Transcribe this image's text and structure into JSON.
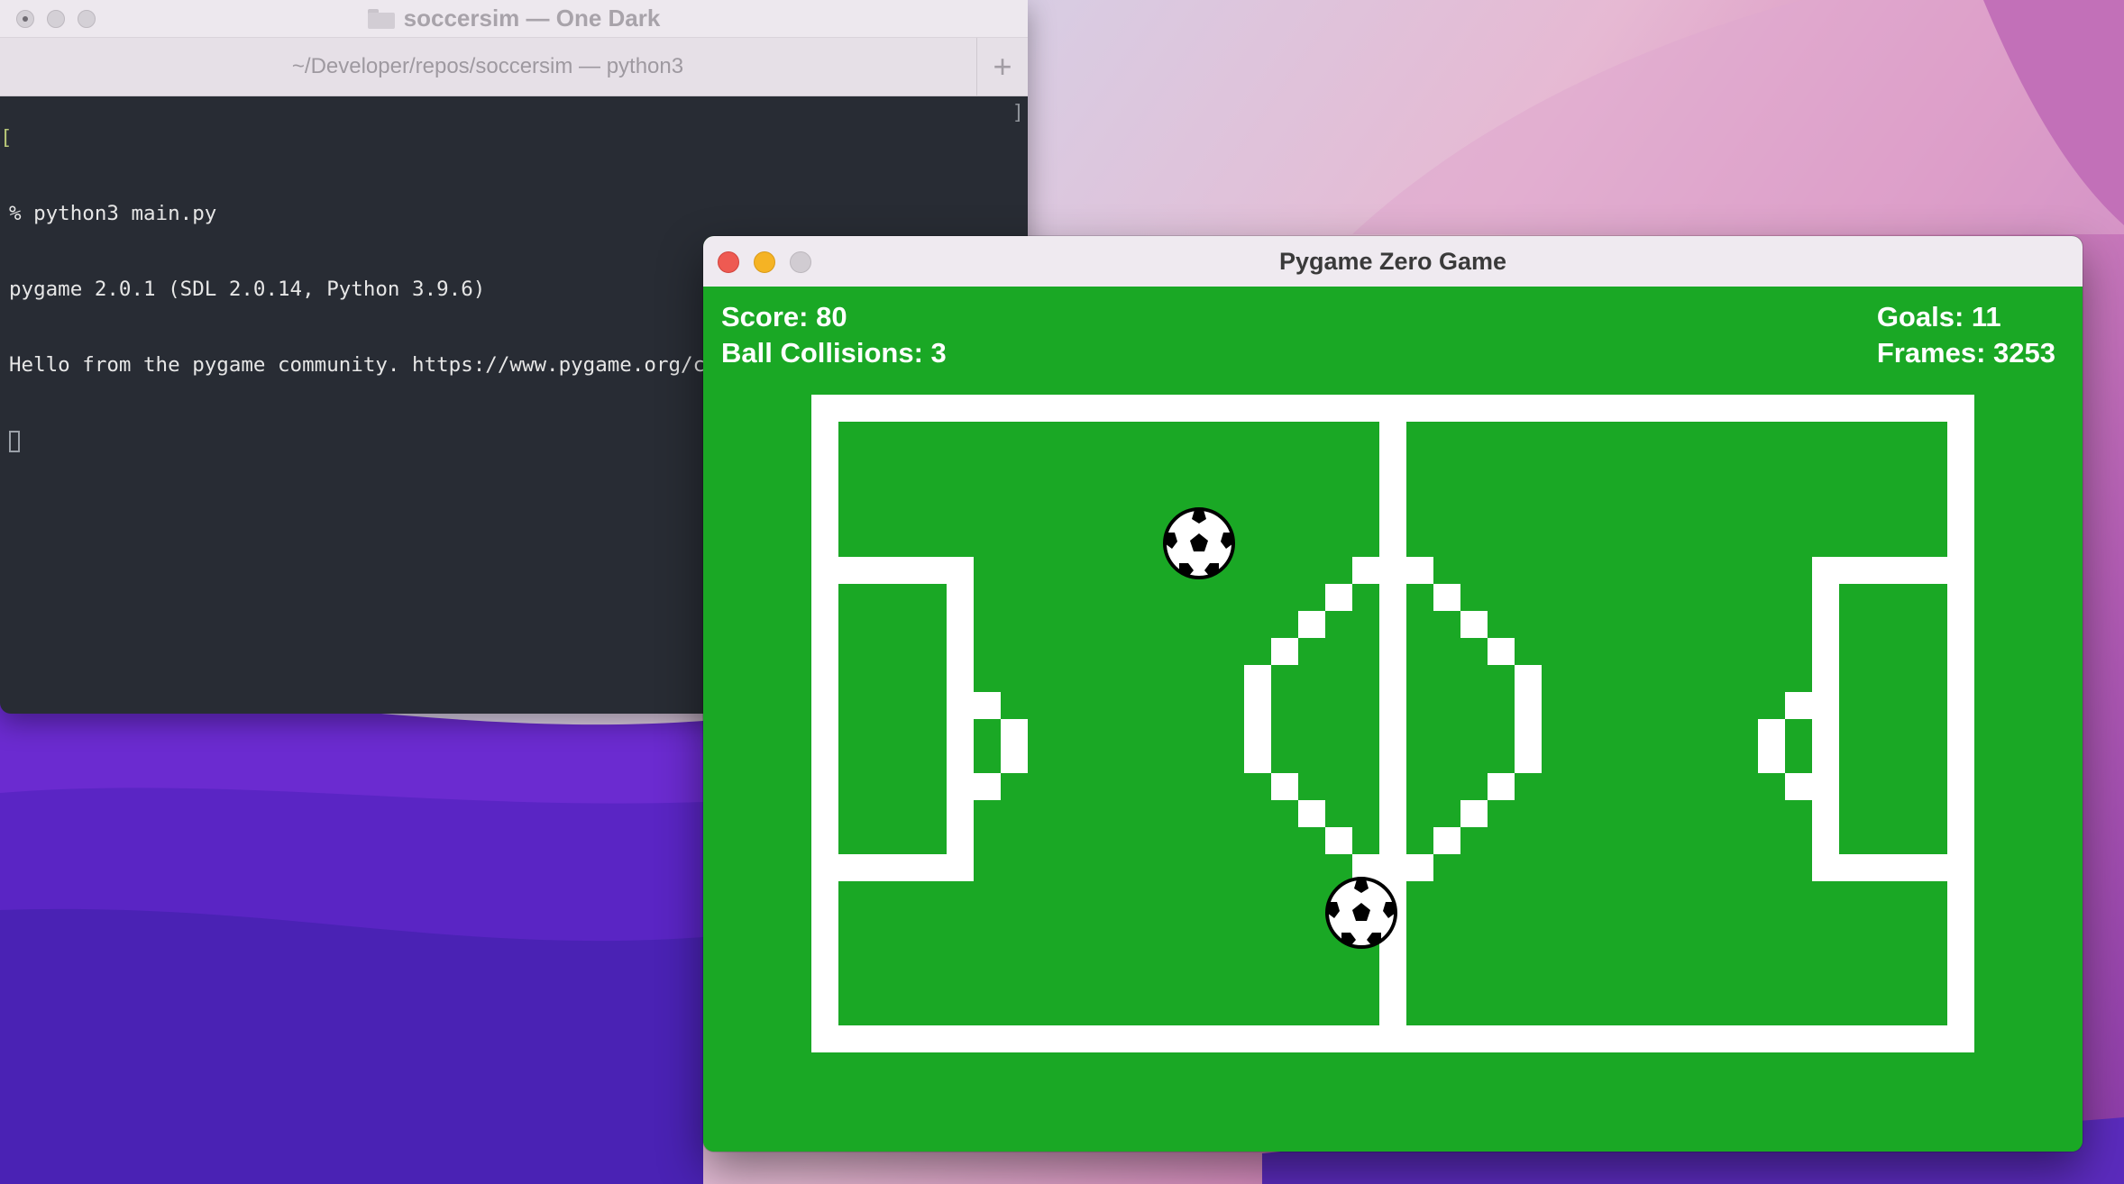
{
  "terminal": {
    "title": "soccersim — One Dark",
    "tab_label": "~/Developer/repos/soccersim — python3",
    "new_tab_symbol": "+",
    "prompt_bracket": "[",
    "lines": [
      "% python3 main.py",
      "pygame 2.0.1 (SDL 2.0.14, Python 3.9.6)",
      "Hello from the pygame community. https://www.pygame.org/contribute.html"
    ],
    "right_bracket": "]"
  },
  "game_window": {
    "title": "Pygame Zero Game",
    "score_text": "Score: 80",
    "collisions_text": "Ball Collisions: 3",
    "goals_text": "Goals: 11",
    "frames_text": "Frames: 3253"
  },
  "colors": {
    "pitch_green": "#1aa825",
    "line_white": "#ffffff",
    "terminal_bg": "#282c34"
  }
}
